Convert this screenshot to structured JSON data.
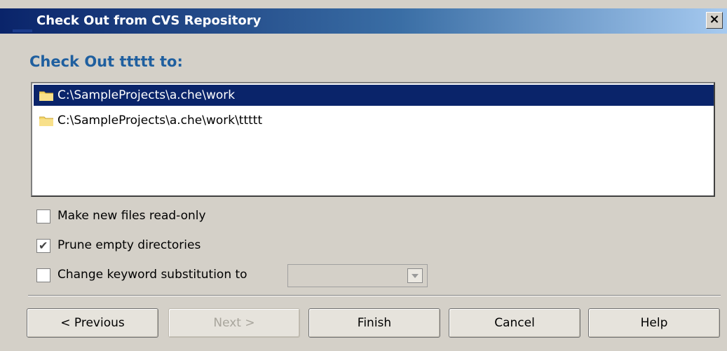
{
  "window": {
    "title": "Check Out from CVS Repository",
    "close_glyph": "✕"
  },
  "heading": "Check Out ttttt to:",
  "locations": [
    {
      "label": "C:\\SampleProjects\\a.che\\work",
      "selected": true,
      "icon": "folder-icon"
    },
    {
      "label": "C:\\SampleProjects\\a.che\\work\\ttttt",
      "selected": false,
      "icon": "folder-icon"
    }
  ],
  "options": {
    "read_only": {
      "label": "Make new files read-only",
      "checked": false
    },
    "prune": {
      "label": "Prune empty directories",
      "checked": true
    },
    "keyword": {
      "label": "Change keyword substitution to",
      "checked": false,
      "value": ""
    }
  },
  "buttons": {
    "previous": "< Previous",
    "next": "Next >",
    "finish": "Finish",
    "cancel": "Cancel",
    "help": "Help"
  },
  "colors": {
    "title_gradient_start": "#0a246a",
    "title_gradient_end": "#a6caf0",
    "heading": "#1f5f9f",
    "selection": "#0a246a",
    "face": "#d4d0c8"
  }
}
